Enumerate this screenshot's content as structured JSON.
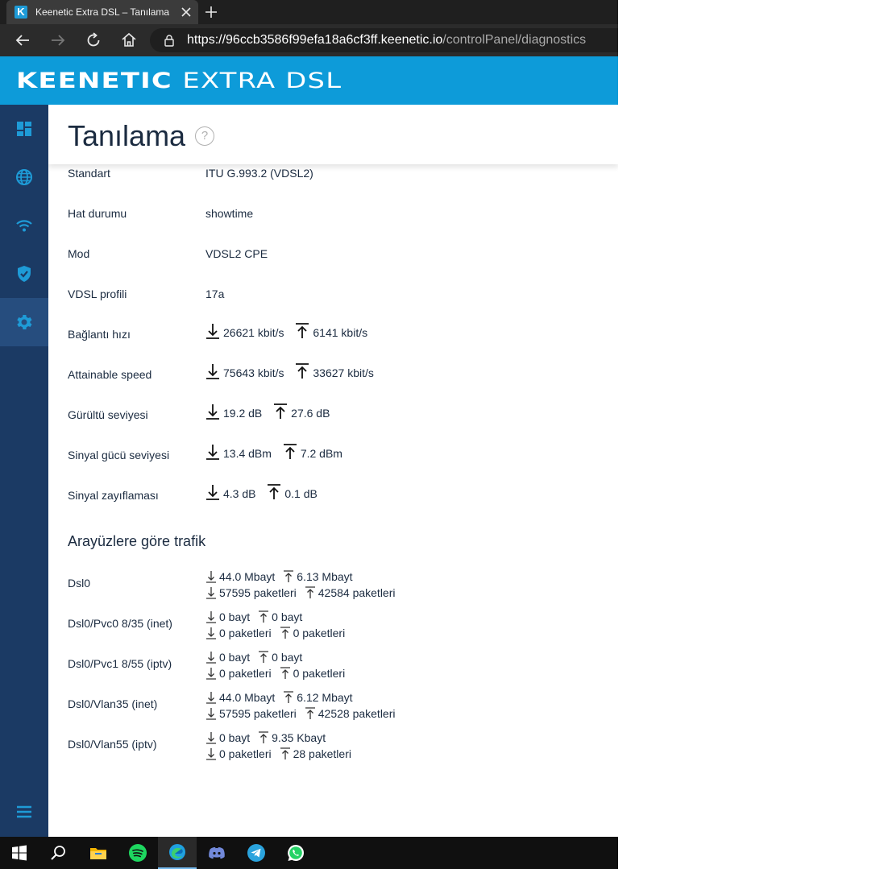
{
  "browser": {
    "tab_title": "Keenetic Extra DSL – Tanılama",
    "favicon_letter": "K",
    "url_scheme": "https://",
    "url_host": "96ccb3586f99efa18a6cf3ff.keenetic.io",
    "url_path": "/controlPanel/diagnostics"
  },
  "app": {
    "logo_brand": "KEENETIC",
    "logo_model": "EXTRA DSL",
    "accent": "#0d9bd9",
    "sidebar_color": "#1b3a64"
  },
  "sidebar": {
    "items": [
      {
        "name": "dashboard",
        "icon": "dashboard-icon"
      },
      {
        "name": "internet",
        "icon": "globe-icon"
      },
      {
        "name": "wifi",
        "icon": "wifi-icon"
      },
      {
        "name": "security",
        "icon": "shield-check-icon"
      },
      {
        "name": "management",
        "icon": "gear-icon",
        "active": true
      }
    ],
    "bottom_icon": "menu-icon"
  },
  "page": {
    "title": "Tanılama",
    "help": "?"
  },
  "dsl_rows": [
    {
      "label": "Standart",
      "value": "ITU G.993.2 (VDSL2)"
    },
    {
      "label": "Hat durumu",
      "value": "showtime"
    },
    {
      "label": "Mod",
      "value": "VDSL2 CPE"
    },
    {
      "label": "VDSL profili",
      "value": "17a"
    }
  ],
  "dsl_speed_rows": [
    {
      "label": "Bağlantı hızı",
      "down": "26621 kbit/s",
      "up": "6141 kbit/s"
    },
    {
      "label": "Attainable speed",
      "down": "75643 kbit/s",
      "up": "33627 kbit/s"
    },
    {
      "label": "Gürültü seviyesi",
      "down": "19.2 dB",
      "up": "27.6 dB"
    },
    {
      "label": "Sinyal gücü seviyesi",
      "down": "13.4 dBm",
      "up": "7.2 dBm"
    },
    {
      "label": "Sinyal zayıflaması",
      "down": "4.3 dB",
      "up": "0.1 dB"
    }
  ],
  "traffic": {
    "title": "Arayüzlere göre trafik",
    "rows": [
      {
        "label": "Dsl0",
        "down_bytes": "44.0 Mbayt",
        "up_bytes": "6.13 Mbayt",
        "down_pkts": "57595 paketleri",
        "up_pkts": "42584 paketleri"
      },
      {
        "label": "Dsl0/Pvc0 8/35 (inet)",
        "down_bytes": "0 bayt",
        "up_bytes": "0 bayt",
        "down_pkts": "0 paketleri",
        "up_pkts": "0 paketleri"
      },
      {
        "label": "Dsl0/Pvc1 8/55 (iptv)",
        "down_bytes": "0 bayt",
        "up_bytes": "0 bayt",
        "down_pkts": "0 paketleri",
        "up_pkts": "0 paketleri"
      },
      {
        "label": "Dsl0/Vlan35 (inet)",
        "down_bytes": "44.0 Mbayt",
        "up_bytes": "6.12 Mbayt",
        "down_pkts": "57595 paketleri",
        "up_pkts": "42528 paketleri"
      },
      {
        "label": "Dsl0/Vlan55 (iptv)",
        "down_bytes": "0 bayt",
        "up_bytes": "9.35 Kbayt",
        "down_pkts": "0 paketleri",
        "up_pkts": "28 paketleri"
      }
    ]
  },
  "taskbar": {
    "items": [
      "windows-start-icon",
      "search-icon",
      "file-explorer-icon",
      "spotify-icon",
      "edge-icon",
      "discord-icon",
      "telegram-icon",
      "whatsapp-icon"
    ],
    "active": "edge-icon"
  }
}
